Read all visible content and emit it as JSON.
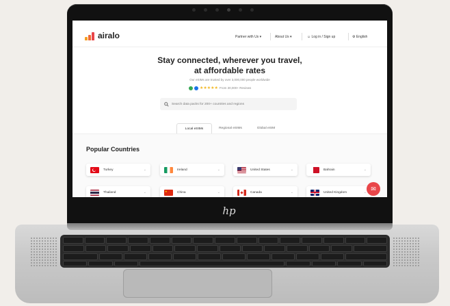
{
  "site": {
    "logo_text": "airalo",
    "nav": {
      "partner": "Partner with Us ▾",
      "about": "About Us ▾",
      "login": "Log in / Sign up",
      "language": "English"
    },
    "hero": {
      "title_line1": "Stay connected, wherever you travel,",
      "title_line2": "at affordable rates",
      "trust_text": "Our eSIMs are trusted by over 3,000,000 people worldwide",
      "rating_text": "From 30,000+ Reviews"
    },
    "search": {
      "placeholder": "Search data packs for 200+ countries and regions"
    },
    "tabs": [
      "Local eSIMs",
      "Regional eSIMs",
      "Global eSIM"
    ],
    "active_tab": "Local eSIMs",
    "popular": {
      "title": "Popular Countries",
      "countries": [
        "Turkey",
        "Ireland",
        "United States",
        "Bahrain",
        "Thailand",
        "China",
        "Canada",
        "United Kingdom"
      ]
    }
  },
  "colors": {
    "brand_red": "#e9464a",
    "brand_orange": "#f4a024",
    "star": "#f2b824"
  },
  "icons": {
    "search": "search-icon",
    "globe": "globe-icon",
    "user": "user-icon",
    "chevron": "chevron-down-icon",
    "chat": "chat-icon"
  },
  "device": {
    "brand_mark": "hp"
  }
}
